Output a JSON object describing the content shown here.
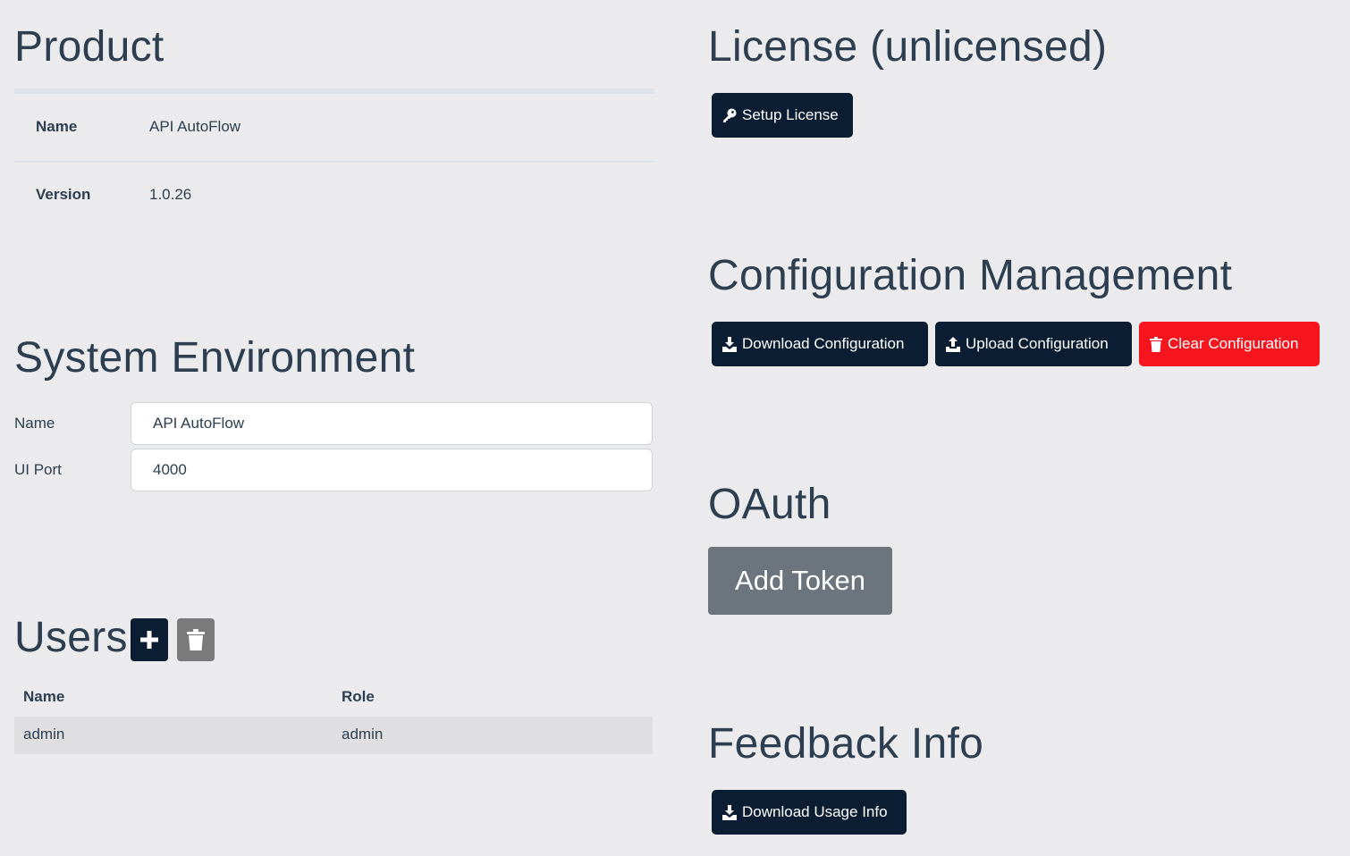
{
  "product": {
    "title": "Product",
    "rows": [
      {
        "key": "Name",
        "value": "API AutoFlow"
      },
      {
        "key": "Version",
        "value": "1.0.26"
      }
    ]
  },
  "system_env": {
    "title": "System Environment",
    "name_label": "Name",
    "name_value": "API AutoFlow",
    "port_label": "UI Port",
    "port_value": "4000"
  },
  "users": {
    "title": "Users",
    "add_icon": "plus-icon",
    "delete_icon": "trash-icon",
    "columns": [
      "Name",
      "Role"
    ],
    "rows": [
      {
        "name": "admin",
        "role": "admin"
      }
    ]
  },
  "license": {
    "title": "License (unlicensed)",
    "setup_label": "Setup License",
    "setup_icon": "key-icon"
  },
  "config": {
    "title": "Configuration Management",
    "download_label": "Download Configuration",
    "upload_label": "Upload Configuration",
    "clear_label": "Clear Configuration"
  },
  "oauth": {
    "title": "OAuth",
    "add_token_label": "Add Token"
  },
  "feedback": {
    "title": "Feedback Info",
    "download_usage_label": "Download Usage Info"
  },
  "colors": {
    "background": "#ebebed",
    "text": "#2c3e50",
    "primary_button": "#0b1d33",
    "danger_button": "#f6141e",
    "secondary_button": "#6c757d"
  }
}
